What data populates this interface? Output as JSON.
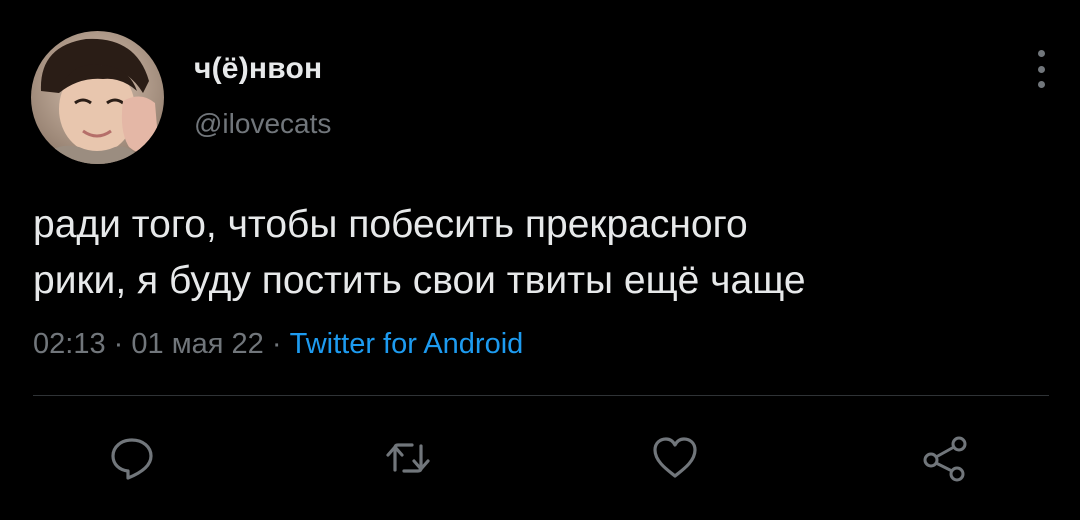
{
  "tweet": {
    "author": {
      "display_name": "ч(ё)нвон",
      "handle": "@ilovecats",
      "avatar_icon": "profile-photo"
    },
    "text_lines": [
      "ради того, чтобы побесить прекрасного",
      "рики, я буду постить свои твиты ещё чаще"
    ],
    "time": "02:13",
    "date": "01 мая 22",
    "separator": "·",
    "source": "Twitter for Android"
  },
  "actions": [
    {
      "name": "reply",
      "icon": "reply-icon"
    },
    {
      "name": "retweet",
      "icon": "retweet-icon"
    },
    {
      "name": "like",
      "icon": "heart-icon"
    },
    {
      "name": "share",
      "icon": "share-icon"
    }
  ],
  "colors": {
    "background": "#000000",
    "text": "#e7e9ea",
    "secondary_text": "#71767b",
    "link": "#1d9bf0",
    "divider": "#2f3336"
  }
}
